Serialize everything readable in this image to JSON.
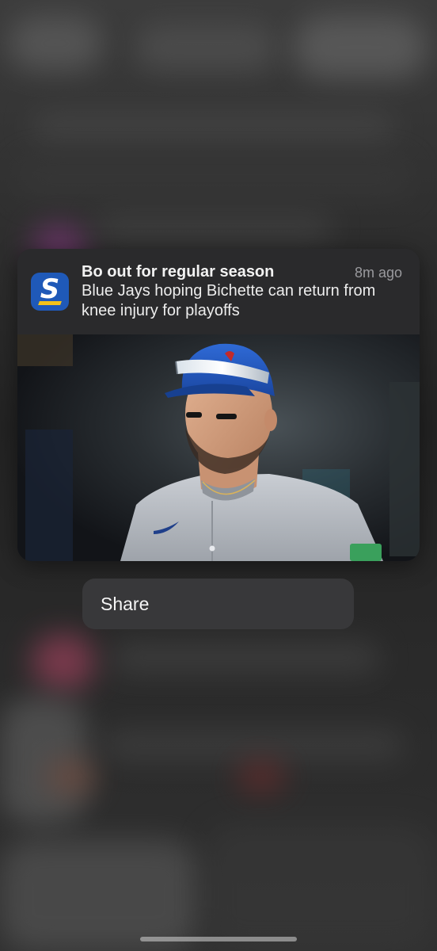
{
  "notification": {
    "app_icon": "thescore-app-icon",
    "app_icon_letter": "S",
    "title": "Bo out for regular season",
    "time": "8m ago",
    "body": "Blue Jays hoping Bichette can return from knee injury for playoffs",
    "image": "baseball-player-photo",
    "colors": {
      "icon_bg": "#1f59b8",
      "icon_accent": "#f4c21a",
      "card_bg": "#2b2b2d"
    }
  },
  "actions": {
    "share_label": "Share"
  }
}
